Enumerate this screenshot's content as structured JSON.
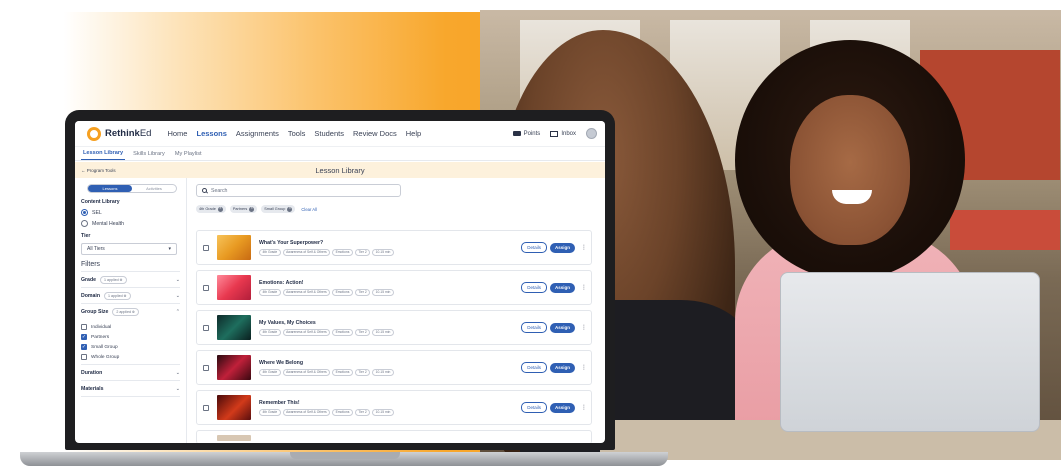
{
  "brand": {
    "name_bold": "Rethink",
    "name_light": "Ed",
    "accent": "#f6a021",
    "primary": "#2f5fb3"
  },
  "topnav": {
    "items": [
      "Home",
      "Lessons",
      "Assignments",
      "Tools",
      "Students",
      "Review Docs",
      "Help"
    ],
    "active": "Lessons",
    "points_label": "Points",
    "inbox_label": "Inbox"
  },
  "subnav": {
    "items": [
      "Lesson Library",
      "Skills Library",
      "My Playlist"
    ],
    "active": "Lesson Library"
  },
  "titlebar": {
    "back_label": "← Program Tools",
    "title": "Lesson Library"
  },
  "sidebar": {
    "toggle": [
      "Lessons",
      "Activities"
    ],
    "content_library": {
      "heading": "Content Library",
      "options": [
        "SEL",
        "Mental Health"
      ],
      "selected": "SEL"
    },
    "tier": {
      "heading": "Tier",
      "value": "All Tiers"
    },
    "filters_heading": "Filters",
    "filters": [
      {
        "label": "Grade",
        "applied": "1 applied ⊗"
      },
      {
        "label": "Domain",
        "applied": "1 applied ⊗"
      }
    ],
    "group_size": {
      "label": "Group Size",
      "applied": "2 applied ⊗",
      "options": [
        {
          "label": "Individual",
          "checked": false
        },
        {
          "label": "Partners",
          "checked": true
        },
        {
          "label": "Small Group",
          "checked": true
        },
        {
          "label": "Whole Group",
          "checked": false
        }
      ]
    },
    "more_filters": [
      "Duration",
      "Materials"
    ]
  },
  "main": {
    "search_placeholder": "Search",
    "chips": [
      "4th Grade",
      "Partners",
      "Small Group"
    ],
    "clear_all": "Clear All",
    "details_label": "Details",
    "assign_label": "Assign",
    "lessons": [
      {
        "title": "What's Your Superpower?",
        "tags": [
          "4th Grade",
          "Awareness of Self & Others",
          "Emotions",
          "Tier 2",
          "10-15 min"
        ]
      },
      {
        "title": "Emotions: Action!",
        "tags": [
          "4th Grade",
          "Awareness of Self & Others",
          "Emotions",
          "Tier 2",
          "10-15 min"
        ]
      },
      {
        "title": "My Values, My Choices",
        "tags": [
          "4th Grade",
          "Awareness of Self & Others",
          "Emotions",
          "Tier 2",
          "10-15 min"
        ]
      },
      {
        "title": "Where We Belong",
        "tags": [
          "4th Grade",
          "Awareness of Self & Others",
          "Emotions",
          "Tier 2",
          "10-15 min"
        ]
      },
      {
        "title": "Remember This!",
        "tags": [
          "4th Grade",
          "Awareness of Self & Others",
          "Emotions",
          "Tier 2",
          "10-15 min"
        ]
      }
    ]
  }
}
